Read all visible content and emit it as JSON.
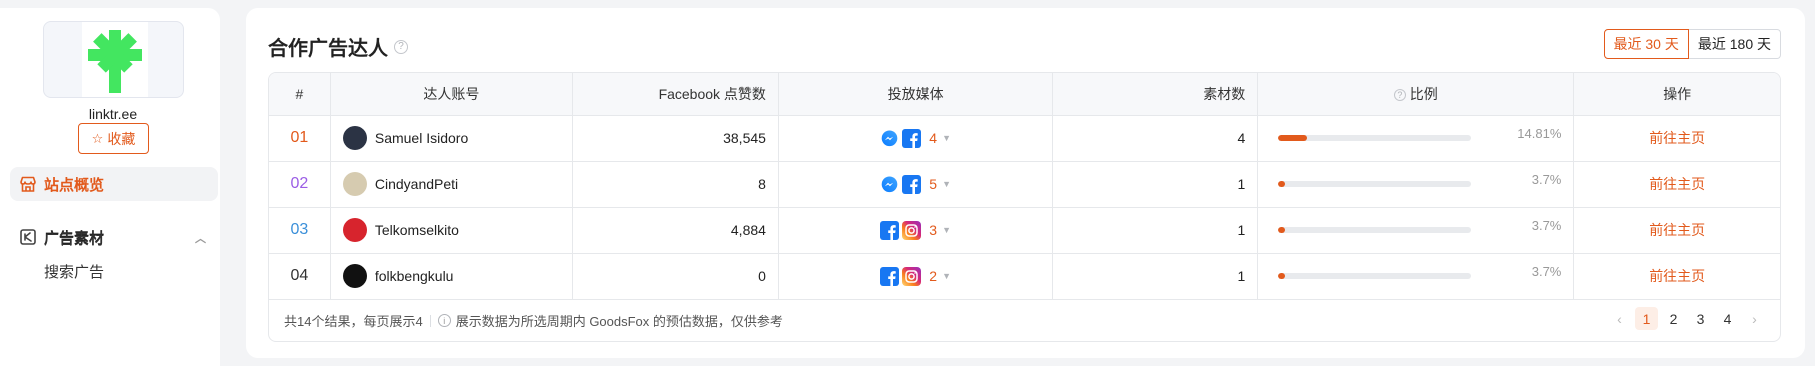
{
  "sidebar": {
    "site_name": "linktr.ee",
    "favorite_label": "收藏",
    "overview_label": "站点概览",
    "ads_group_label": "广告素材",
    "ads_sub": [
      "广告素材",
      "搜索广告"
    ]
  },
  "card": {
    "title": "合作广告达人",
    "periods": [
      "最近 30 天",
      "最近 180 天"
    ],
    "active_period": "最近 30 天"
  },
  "table": {
    "headers": [
      "#",
      "达人账号",
      "Facebook 点赞数",
      "投放媒体",
      "素材数",
      "比例",
      "操作"
    ],
    "rows": [
      {
        "rank": "01",
        "rank_color": "#e25a1c",
        "account": "Samuel Isidoro",
        "avatar_color": "#2b3344",
        "likes": "38,545",
        "media": [
          "messenger",
          "facebook"
        ],
        "media_count": "4",
        "creatives": "4",
        "ratio_value": 14.81,
        "ratio": "14.81%",
        "action": "前往主页"
      },
      {
        "rank": "02",
        "rank_color": "#9b5de5",
        "account": "CindyandPeti",
        "avatar_color": "#d6cbb0",
        "likes": "8",
        "media": [
          "messenger",
          "facebook"
        ],
        "media_count": "5",
        "creatives": "1",
        "ratio_value": 3.7,
        "ratio": "3.7%",
        "action": "前往主页"
      },
      {
        "rank": "03",
        "rank_color": "#3a8fd9",
        "account": "Telkomselkito",
        "avatar_color": "#d7242d",
        "likes": "4,884",
        "media": [
          "facebook",
          "instagram"
        ],
        "media_count": "3",
        "creatives": "1",
        "ratio_value": 3.7,
        "ratio": "3.7%",
        "action": "前往主页"
      },
      {
        "rank": "04",
        "rank_color": "#333333",
        "account": "folkbengkulu",
        "avatar_color": "#111111",
        "likes": "0",
        "media": [
          "facebook",
          "instagram"
        ],
        "media_count": "2",
        "creatives": "1",
        "ratio_value": 3.7,
        "ratio": "3.7%",
        "action": "前往主页"
      }
    ]
  },
  "footer": {
    "summary": "共14个结果，每页展示4",
    "note": "展示数据为所选周期内 GoodsFox 的预估数据，仅供参考",
    "pages": [
      "1",
      "2",
      "3",
      "4"
    ],
    "current_page": "1"
  },
  "colors": {
    "accent": "#e25a1c",
    "brand_logo": "#43e660"
  }
}
